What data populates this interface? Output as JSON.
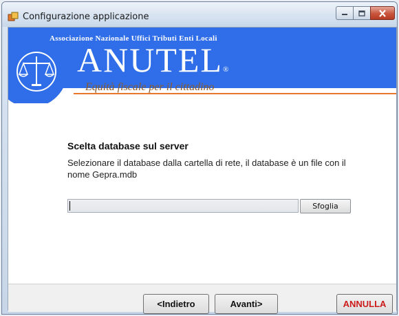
{
  "window": {
    "title": "Configurazione applicazione",
    "controls": [
      "minimize-icon",
      "maximize-icon",
      "close-icon"
    ]
  },
  "banner": {
    "association": "Associazione Nazionale Uffici Tributi Enti Locali",
    "logo_text": "ANUTEL",
    "registered_mark": "®",
    "slogan": "Equità fiscale per il cittadino",
    "colors": {
      "blue": "#2f6ee8",
      "accent_line": "#e8772a",
      "slogan": "#8a5a2a"
    }
  },
  "content": {
    "heading": "Scelta database sul server",
    "description": "Selezionare il database dalla cartella di rete, il database è un file con il nome Gepra.mdb",
    "path_value": "",
    "browse_label": "Sfoglia"
  },
  "footer": {
    "back_label": "<Indietro",
    "next_label": "Avanti>",
    "cancel_label": "ANNULLA",
    "cancel_color": "#cc1a1a"
  }
}
